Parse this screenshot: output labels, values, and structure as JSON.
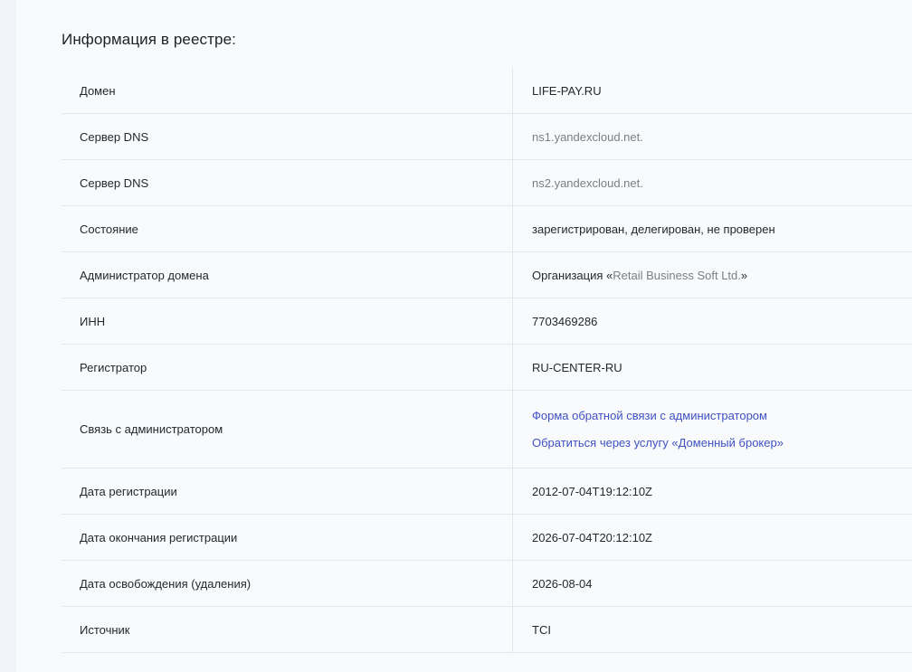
{
  "section": {
    "title": "Информация в реестре:"
  },
  "rows": {
    "domain": {
      "label": "Домен",
      "value": "LIFE-PAY.RU"
    },
    "dns1": {
      "label": "Сервер DNS",
      "value": "ns1.yandexcloud.net."
    },
    "dns2": {
      "label": "Сервер DNS",
      "value": "ns2.yandexcloud.net."
    },
    "state": {
      "label": "Состояние",
      "value": "зарегистрирован, делегирован, не проверен"
    },
    "admin": {
      "label": "Администратор домена",
      "prefix": "Организация «",
      "org": "Retail Business Soft Ltd.",
      "suffix": "»"
    },
    "inn": {
      "label": "ИНН",
      "value": "7703469286"
    },
    "registrar": {
      "label": "Регистратор",
      "value": "RU-CENTER-RU"
    },
    "contact": {
      "label": "Связь с администратором",
      "link_feedback": "Форма обратной связи с администратором",
      "link_broker": "Обратиться через услугу «Доменный брокер»"
    },
    "created": {
      "label": "Дата регистрации",
      "value": "2012-07-04T19:12:10Z"
    },
    "expires": {
      "label": "Дата окончания регистрации",
      "value": "2026-07-04T20:12:10Z"
    },
    "release": {
      "label": "Дата освобождения (удаления)",
      "value": "2026-08-04"
    },
    "source": {
      "label": "Источник",
      "value": "TCI"
    }
  },
  "colors": {
    "link": "#3f51c4",
    "muted": "#7a7f86",
    "text": "#25282b",
    "border": "#e3e6ea",
    "background": "#f8fafb"
  }
}
